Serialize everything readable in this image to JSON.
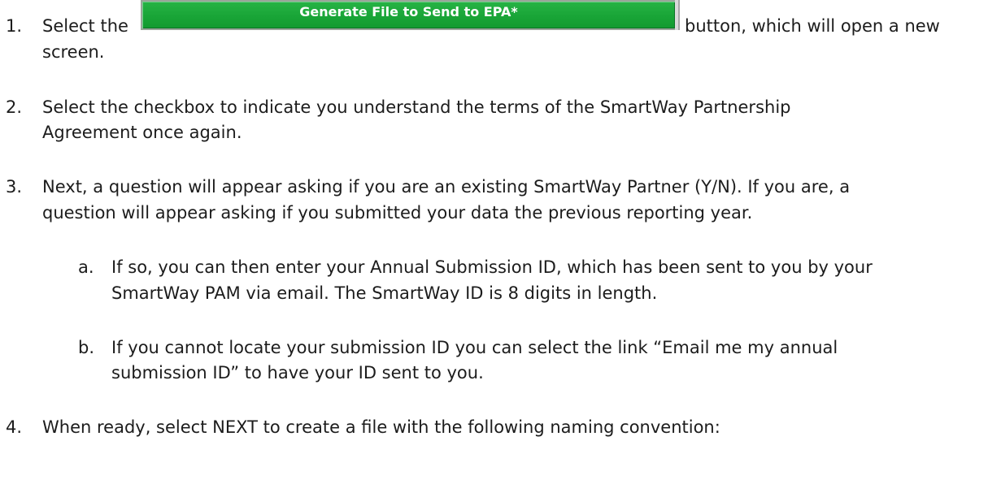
{
  "steps": [
    {
      "number": "1.",
      "before": "Select the",
      "button_label": "Generate File to Send to EPA*",
      "after": "button, which will open a new",
      "continuation": "screen."
    },
    {
      "number": "2.",
      "line1": "Select the checkbox to indicate you understand the terms of the SmartWay Partnership",
      "line2": "Agreement once again."
    },
    {
      "number": "3.",
      "line1": "Next, a question will appear asking if you are an existing SmartWay Partner (Y/N).  If you are, a",
      "line2": "question will appear asking if you submitted your data the previous reporting year.",
      "substeps": [
        {
          "letter": "a.",
          "line1": "If so, you can then enter your Annual Submission ID, which has been sent to you by your",
          "line2": "SmartWay PAM via email.  The SmartWay ID is 8 digits in length."
        },
        {
          "letter": "b.",
          "line1": "If you cannot locate your submission ID you can select the link “Email me my annual",
          "line2": "submission ID” to have your ID sent to you."
        }
      ]
    },
    {
      "number": "4.",
      "line1": "When ready, select NEXT to create a file with the following naming convention:"
    }
  ]
}
